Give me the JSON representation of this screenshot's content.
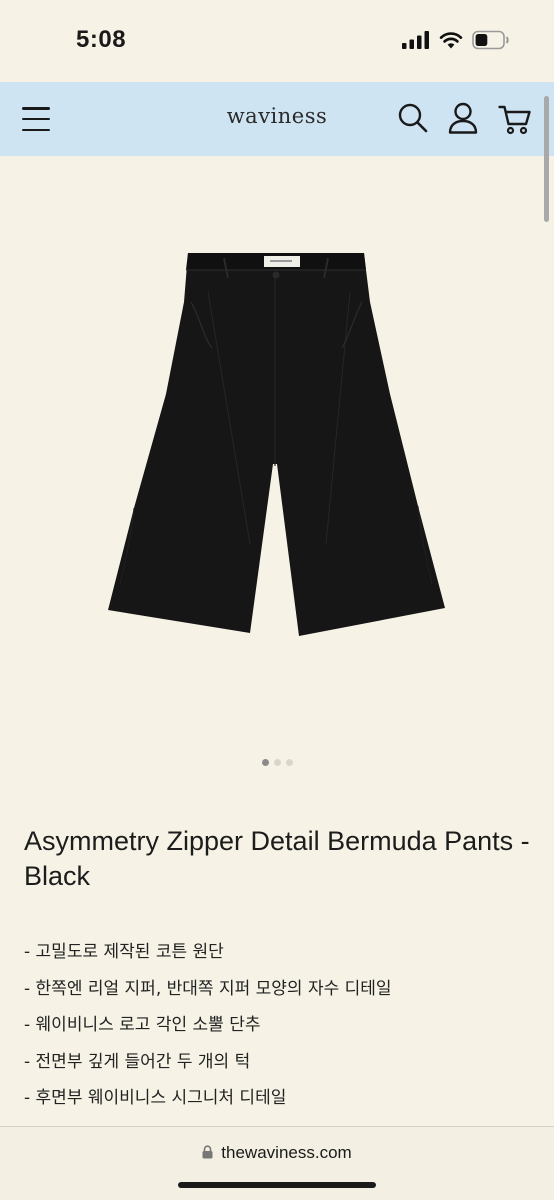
{
  "status_bar": {
    "time": "5:08",
    "battery_level": 0.45
  },
  "nav": {
    "brand": "waviness",
    "icons": [
      "menu-icon",
      "search-icon",
      "user-icon",
      "cart-icon"
    ],
    "background": "#cfe4f3"
  },
  "gallery": {
    "image_alt": "Black pleated bermuda pants",
    "page_count": 3,
    "active_index": 0
  },
  "product": {
    "title": "Asymmetry Zipper Detail Bermuda Pants - Black",
    "details": [
      "- 고밀도로 제작된 코튼 원단",
      "- 한쪽엔 리얼 지퍼, 반대쪽 지퍼 모양의 자수 디테일",
      "- 웨이비니스 로고 각인 소뿔 단추",
      "- 전면부 깊게 들어간 두 개의 턱",
      "- 후면부 웨이비니스 시그니처 디테일"
    ]
  },
  "browser": {
    "url": "thewaviness.com"
  },
  "colors": {
    "page_bg": "#f6f3e6",
    "text": "#1a1a1a"
  }
}
